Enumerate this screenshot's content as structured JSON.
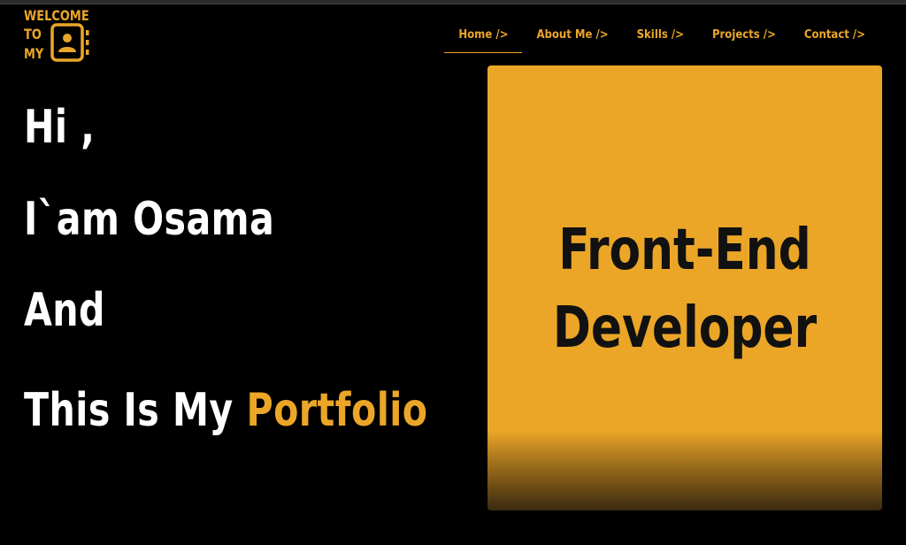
{
  "logo": {
    "line1": "WELCOME",
    "line2": "TO",
    "line3": "MY",
    "icon": "contact-book-icon",
    "color": "#eba628"
  },
  "nav": {
    "items": [
      {
        "label": "Home />",
        "active": true
      },
      {
        "label": "About Me />",
        "active": false
      },
      {
        "label": "Skills />",
        "active": false
      },
      {
        "label": "Projects />",
        "active": false
      },
      {
        "label": "Contact />",
        "active": false
      }
    ]
  },
  "hero": {
    "line1": "Hi ,",
    "line2": "I`am Osama",
    "line3": "And",
    "line4_prefix": "This Is My",
    "line4_accent": "Portfolio"
  },
  "card": {
    "line1": "Front-End",
    "line2": "Developer"
  },
  "colors": {
    "background": "#000000",
    "accent": "#eba628",
    "text": "#ffffff",
    "card_text": "#111111"
  }
}
